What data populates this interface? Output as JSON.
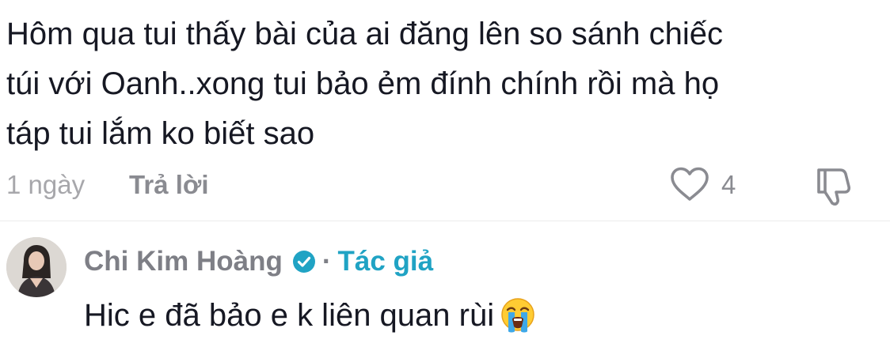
{
  "comment": {
    "text": "Hôm qua tui thấy bài của ai đăng lên so sánh chiếc\ntúi với Oanh..xong tui bảo ẻm đính chính rồi mà họ\ntáp tui lắm ko biết sao",
    "timestamp": "1 ngày",
    "reply_label": "Trả lời",
    "like_count": "4",
    "icons": {
      "like": "heart-outline-icon",
      "dislike": "thumbs-down-icon"
    }
  },
  "reply": {
    "author_name": "Chi Kim Hoàng",
    "separator": "·",
    "author_tag": "Tác giả",
    "text": "Hic e đã bảo e k liên quan rùi",
    "verified_color": "#20a3c4",
    "tag_color": "#20a3c4",
    "icons": {
      "avatar": "avatar",
      "verified": "verified-badge-icon",
      "emoji": "loudly-crying-face-emoji"
    }
  }
}
